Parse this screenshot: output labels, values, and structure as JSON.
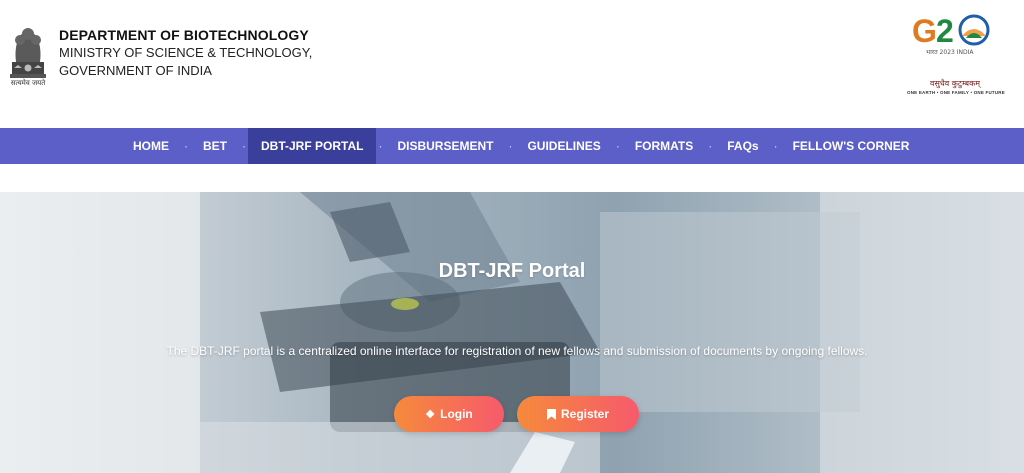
{
  "header": {
    "emblem_caption": "सत्यमेव जयते",
    "dept_line1": "DEPARTMENT OF BIOTECHNOLOGY",
    "dept_line2": "MINISTRY OF SCIENCE & TECHNOLOGY,",
    "dept_line3": "GOVERNMENT OF INDIA",
    "g20_sub": "भारत 2023 INDIA",
    "g20_hindi": "वसुधैव कुटुम्बकम्",
    "g20_motto": "ONE EARTH • ONE FAMILY • ONE FUTURE"
  },
  "nav": {
    "items": [
      {
        "label": "HOME"
      },
      {
        "label": "BET"
      },
      {
        "label": "DBT-JRF PORTAL"
      },
      {
        "label": "DISBURSEMENT"
      },
      {
        "label": "GUIDELINES"
      },
      {
        "label": "FORMATS"
      },
      {
        "label": "FAQs"
      },
      {
        "label": "FELLOW'S CORNER"
      }
    ]
  },
  "hero": {
    "title": "DBT-JRF Portal",
    "description": "The DBT-JRF portal is a centralized online interface for registration of new fellows and submission of documents by ongoing fellows.",
    "login_label": "Login",
    "register_label": "Register"
  },
  "colors": {
    "nav_bg": "#5b5fc7",
    "nav_active": "#3b3f9c",
    "button_gradient_start": "#f68a3b",
    "button_gradient_end": "#f65a6c"
  }
}
